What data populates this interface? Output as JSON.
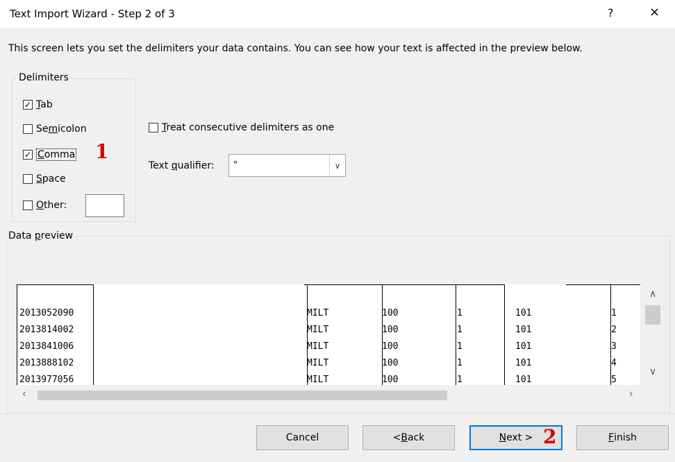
{
  "window": {
    "title": "Text Import Wizard - Step 2 of 3",
    "help_label": "?",
    "close_label": "×"
  },
  "description": "This screen lets you set the delimiters your data contains.  You can see how your text is affected in the preview below.",
  "delimiters": {
    "legend": "Delimiters",
    "tab": {
      "accel": "T",
      "rest": "ab",
      "checked": true
    },
    "semicolon": {
      "pre": "Se",
      "accel": "m",
      "rest": "icolon",
      "checked": false
    },
    "comma": {
      "accel": "C",
      "rest": "omma",
      "checked": true
    },
    "space": {
      "accel": "S",
      "rest": "pace",
      "checked": false
    },
    "other": {
      "accel": "O",
      "rest": "ther:",
      "checked": false,
      "value": ""
    }
  },
  "consecutive": {
    "accel": "T",
    "rest": "reat consecutive delimiters as one",
    "checked": false
  },
  "qualifier": {
    "pre": "Text ",
    "accel": "q",
    "rest": "ualifier:",
    "value": "\""
  },
  "preview": {
    "legend_pre": "Data ",
    "legend_accel": "p",
    "legend_rest": "review",
    "rows": [
      [
        "2013052090",
        "MILT",
        "100",
        "1",
        "101",
        "1"
      ],
      [
        "2013814002",
        "MILT",
        "100",
        "1",
        "101",
        "2"
      ],
      [
        "2013841006",
        "MILT",
        "100",
        "1",
        "101",
        "3"
      ],
      [
        "2013888102",
        "MILT",
        "100",
        "1",
        "101",
        "4"
      ],
      [
        "2013977056",
        "MILT",
        "100",
        "1",
        "101",
        "5"
      ]
    ]
  },
  "annotations": {
    "step1": "1",
    "step2": "2"
  },
  "buttons": {
    "cancel": "Cancel",
    "back_pre": "< ",
    "back_accel": "B",
    "back_rest": "ack",
    "next_accel": "N",
    "next_rest": "ext >",
    "finish_accel": "F",
    "finish_rest": "inish"
  },
  "colors": {
    "accent": "#0078d7",
    "annotation_red": "#d40000"
  }
}
